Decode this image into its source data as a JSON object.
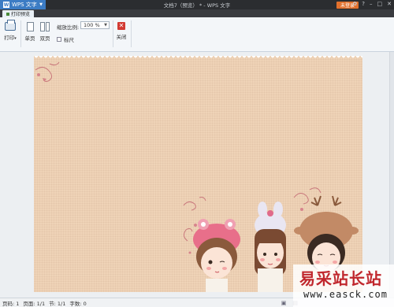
{
  "titlebar": {
    "app_menu_label": "WPS 文字",
    "doc_title": "文档7（预览） * - WPS 文字",
    "login_label": "未登录",
    "icons": [
      "skin-icon",
      "help-icon",
      "minimize-icon",
      "maximize-icon",
      "close-icon"
    ]
  },
  "tabs": [
    {
      "label": "打印预览"
    }
  ],
  "ribbon": {
    "print_label": "打印",
    "single_page_label": "单页",
    "double_page_label": "双页",
    "zoom_label": "缩放比例:",
    "zoom_value": "100 %",
    "ruler_label": "标尺",
    "close_label": "关闭"
  },
  "statusbar": {
    "page": "页码: 1",
    "pages": "页面: 1/1",
    "section": "节: 1/1",
    "word_count": "字数: 0"
  },
  "watermark": {
    "chinese": "易采站长站",
    "url": "www.easck.com"
  },
  "colors": {
    "accent": "#3c7cc4",
    "login": "#e2702c",
    "page_background": "#efd3b7",
    "close": "#d23a32"
  }
}
